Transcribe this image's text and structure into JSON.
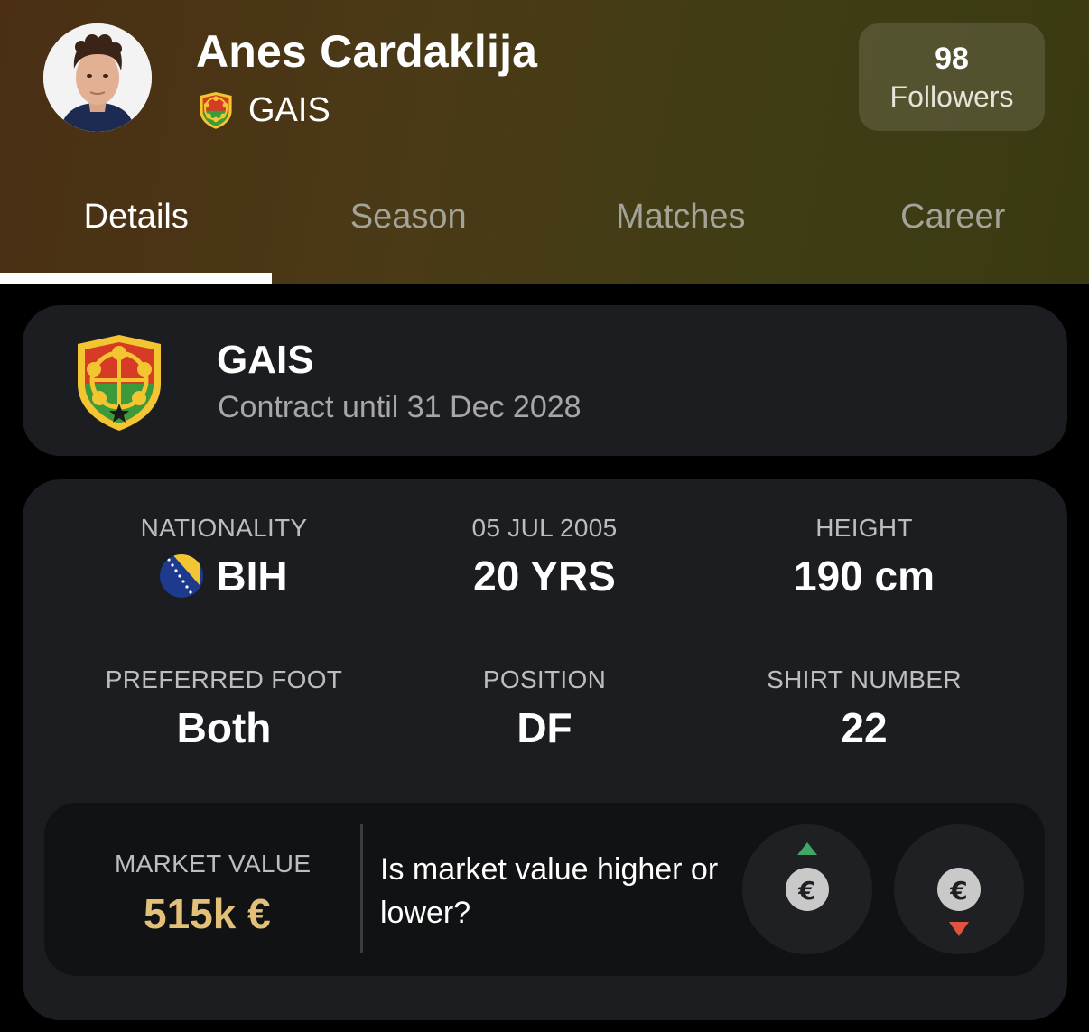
{
  "player": {
    "name": "Anes Cardaklija",
    "team": "GAIS",
    "followers_count": "98",
    "followers_label": "Followers"
  },
  "tabs": [
    {
      "label": "Details",
      "active": true
    },
    {
      "label": "Season",
      "active": false
    },
    {
      "label": "Matches",
      "active": false
    },
    {
      "label": "Career",
      "active": false
    }
  ],
  "club": {
    "name": "GAIS",
    "contract": "Contract until 31 Dec 2028"
  },
  "details": {
    "nationality": {
      "label": "NATIONALITY",
      "value": "BIH"
    },
    "age": {
      "label": "05 JUL 2005",
      "value": "20 YRS"
    },
    "height": {
      "label": "HEIGHT",
      "value": "190 cm"
    },
    "foot": {
      "label": "PREFERRED FOOT",
      "value": "Both"
    },
    "position": {
      "label": "POSITION",
      "value": "DF"
    },
    "shirt": {
      "label": "SHIRT NUMBER",
      "value": "22"
    }
  },
  "market": {
    "label": "MARKET VALUE",
    "value": "515k €",
    "question": "Is market value higher or lower?"
  },
  "colors": {
    "market_value": "#e2c078",
    "up_arrow": "#3fa866",
    "down_arrow": "#e0533e"
  },
  "icons": [
    "euro-icon",
    "arrow-up-icon",
    "arrow-down-icon",
    "club-crest-icon",
    "flag-bih-icon"
  ]
}
